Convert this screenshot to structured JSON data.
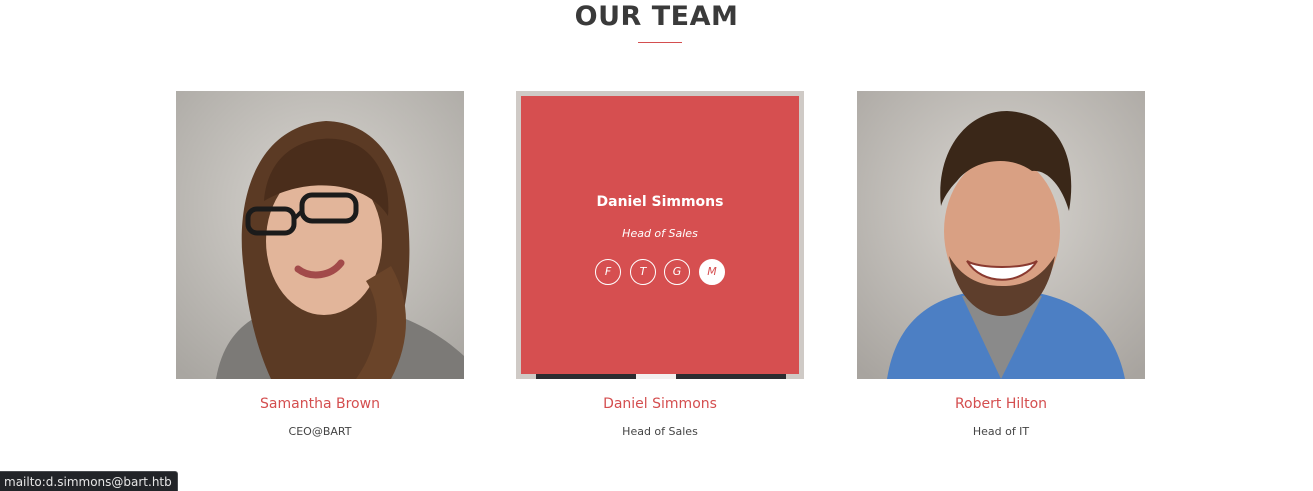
{
  "section": {
    "title": "OUR TEAM",
    "accent_color": "#d64f50"
  },
  "members": [
    {
      "name": "Samantha Brown",
      "role": "CEO@BART",
      "photo": "woman-with-glasses-photo"
    },
    {
      "name": "Daniel Simmons",
      "role": "Head of Sales",
      "photo": "man-photo",
      "overlay": {
        "name": "Daniel Simmons",
        "role": "Head of Sales",
        "social": [
          {
            "label": "F",
            "icon": "facebook-icon"
          },
          {
            "label": "T",
            "icon": "twitter-icon"
          },
          {
            "label": "G",
            "icon": "google-plus-icon"
          },
          {
            "label": "M",
            "icon": "mail-icon",
            "active": true
          }
        ]
      }
    },
    {
      "name": "Robert Hilton",
      "role": "Head of IT",
      "photo": "smiling-man-photo"
    }
  ],
  "status_bar": {
    "text": "mailto:d.simmons@bart.htb"
  }
}
